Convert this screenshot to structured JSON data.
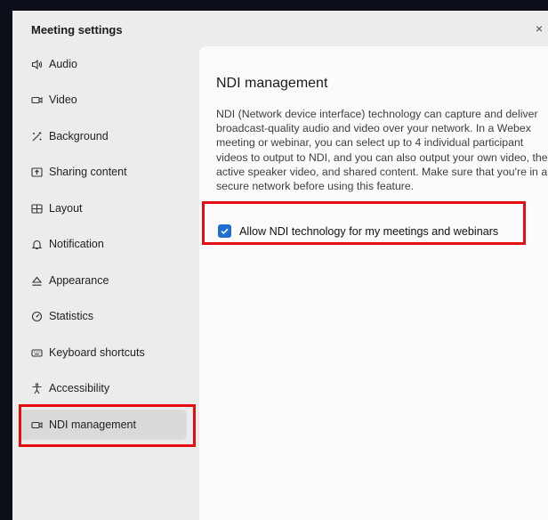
{
  "dialog": {
    "title": "Meeting settings",
    "close_glyph": "×"
  },
  "sidebar": {
    "items": [
      {
        "label": "Audio",
        "icon": "speaker-icon",
        "selected": false
      },
      {
        "label": "Video",
        "icon": "video-camera-icon",
        "selected": false
      },
      {
        "label": "Background",
        "icon": "magic-wand-icon",
        "selected": false
      },
      {
        "label": "Sharing content",
        "icon": "share-screen-icon",
        "selected": false
      },
      {
        "label": "Layout",
        "icon": "grid-layout-icon",
        "selected": false
      },
      {
        "label": "Notification",
        "icon": "bell-icon",
        "selected": false
      },
      {
        "label": "Appearance",
        "icon": "paint-bucket-icon",
        "selected": false
      },
      {
        "label": "Statistics",
        "icon": "gauge-icon",
        "selected": false
      },
      {
        "label": "Keyboard shortcuts",
        "icon": "keyboard-icon",
        "selected": false
      },
      {
        "label": "Accessibility",
        "icon": "accessibility-person-icon",
        "selected": false
      },
      {
        "label": "NDI management",
        "icon": "video-camera-icon",
        "selected": true
      }
    ]
  },
  "content": {
    "title": "NDI management",
    "description": "NDI (Network device interface) technology can capture and deliver broadcast-quality audio and video over your network. In a Webex meeting or webinar, you can select up to 4 individual participant videos to output to NDI, and you can also output your own video, the active speaker video, and shared content. Make sure that you're in a secure network before using this feature.",
    "checkbox": {
      "label": "Allow NDI technology for my meetings and webinars",
      "checked": true
    }
  },
  "colors": {
    "accent": "#1f6fd1",
    "highlight": "#e40d12"
  }
}
